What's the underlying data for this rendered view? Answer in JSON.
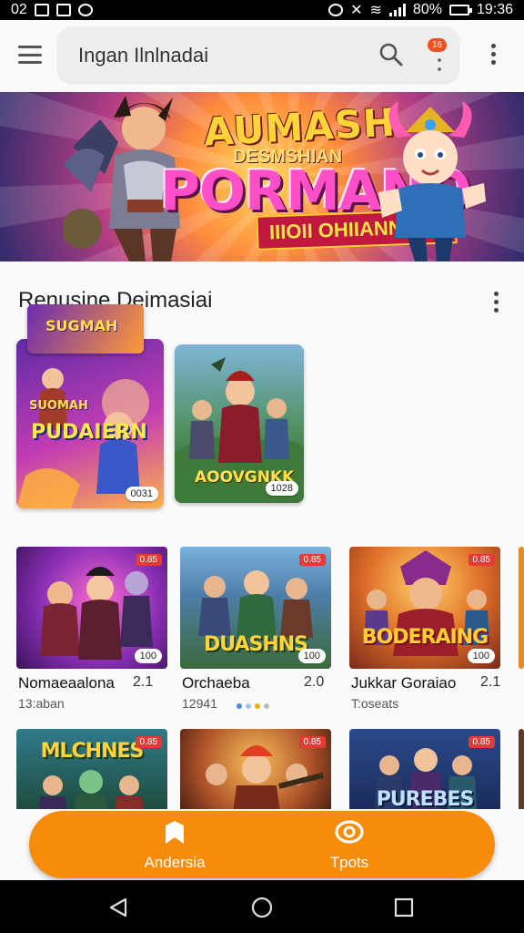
{
  "status_bar": {
    "left_text": "02",
    "battery_percent": "80%",
    "time": "19:36"
  },
  "app_bar": {
    "search_text": "Ingan Ilnlnadai",
    "notification_badge": "16"
  },
  "hero": {
    "title": "AUMASH",
    "subtitle": "DESMSHIAN",
    "main_text": "PORMANO",
    "cta": "IIIOII OHIIANNOSI!"
  },
  "section": {
    "title": "Renusine Deimasiai"
  },
  "featured": [
    {
      "top_label": "SUOMAH",
      "title": "PUDAIERN",
      "top_title": "SUGMAH",
      "size": "0031"
    },
    {
      "title": "AOOVGNKK",
      "size": "1028"
    }
  ],
  "games_row1": [
    {
      "name": "Nomaeaalona",
      "rating": "2.1",
      "meta": "13:aban",
      "badge": "0.85",
      "size": "100",
      "art_title": ""
    },
    {
      "name": "Orchaeba",
      "rating": "2.0",
      "meta": "12941",
      "badge": "0.85",
      "size": "100",
      "art_title": "DUASHNS"
    },
    {
      "name": "Jukkar Goraiao",
      "rating": "2.1",
      "meta": "T:oseats",
      "badge": "0.85",
      "size": "100",
      "art_title": "BODERAING"
    }
  ],
  "games_row2": [
    {
      "art_title": "MLCHNES",
      "badge": "0.85"
    },
    {
      "art_title": "",
      "badge": "0.85"
    },
    {
      "art_title": "PUREBES",
      "badge": "0.85"
    }
  ],
  "bottom_nav": [
    {
      "label": "Andersia",
      "icon": "home-icon"
    },
    {
      "label": "Tpots",
      "icon": "chat-icon"
    }
  ],
  "colors": {
    "accent": "#f68b0c",
    "badge": "#e53935",
    "notif": "#f04e23"
  }
}
